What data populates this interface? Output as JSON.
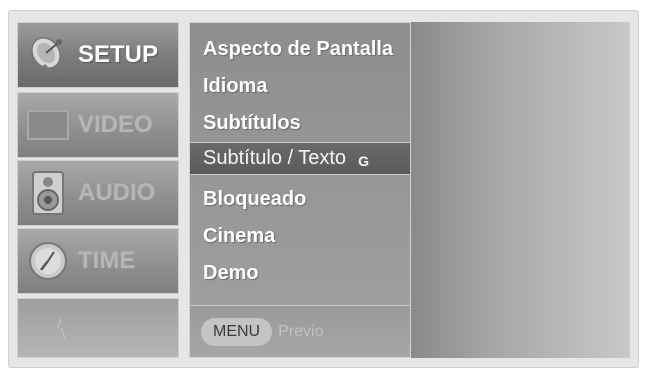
{
  "categories": [
    {
      "label": "SETUP",
      "icon": "satellite-dish-icon",
      "active": true
    },
    {
      "label": "VIDEO",
      "icon": "screen-icon",
      "active": false
    },
    {
      "label": "AUDIO",
      "icon": "speaker-icon",
      "active": false
    },
    {
      "label": "TIME",
      "icon": "clock-icon",
      "active": false
    }
  ],
  "menu": {
    "items": [
      {
        "label": "Aspecto de Pantalla"
      },
      {
        "label": "Idioma"
      },
      {
        "label": "Subtítulos"
      },
      {
        "label": "Subtítulo / Texto",
        "badge": "G"
      },
      {
        "label": "Bloqueado"
      },
      {
        "label": "Cinema"
      },
      {
        "label": "Demo"
      }
    ],
    "selected_index": 3,
    "footer": {
      "button": "MENU",
      "hint": "Previo"
    }
  }
}
